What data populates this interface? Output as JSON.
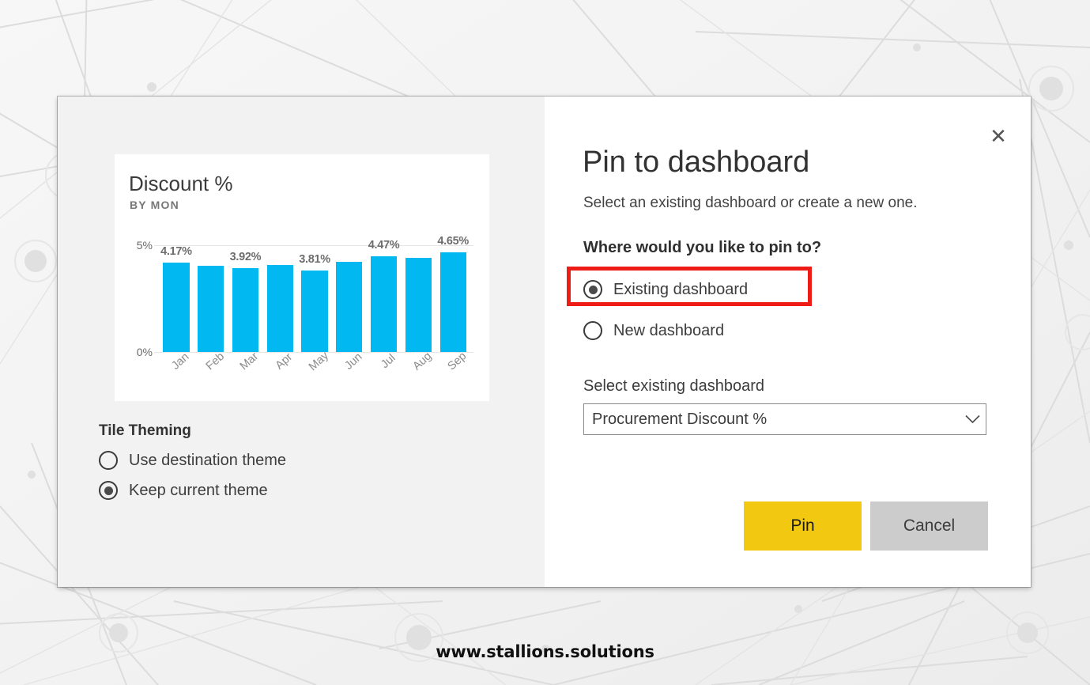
{
  "watermark": "www.stallions.solutions",
  "dialog": {
    "close_icon": "close-icon",
    "title": "Pin to dashboard",
    "subtitle": "Select an existing dashboard or create a new one.",
    "where_heading": "Where would you like to pin to?",
    "destination_options": [
      {
        "label": "Existing dashboard",
        "checked": true,
        "highlighted": true
      },
      {
        "label": "New dashboard",
        "checked": false,
        "highlighted": false
      }
    ],
    "select_label": "Select existing dashboard",
    "select_value": "Procurement Discount %",
    "select_icon": "chevron-down-icon",
    "pin_label": "Pin",
    "cancel_label": "Cancel",
    "highlight_color": "#ee1c16",
    "pin_button_color": "#f2c811",
    "cancel_button_color": "#cccccc"
  },
  "tile_theming": {
    "title": "Tile Theming",
    "options": [
      {
        "label": "Use destination theme",
        "checked": false
      },
      {
        "label": "Keep current theme",
        "checked": true
      }
    ]
  },
  "chart_data": {
    "type": "bar",
    "title": "Discount %",
    "subtitle": "BY MON",
    "xlabel": "",
    "ylabel": "",
    "categories": [
      "Jan",
      "Feb",
      "Mar",
      "Apr",
      "May",
      "Jun",
      "Jul",
      "Aug",
      "Sep"
    ],
    "values": [
      4.17,
      4.02,
      3.92,
      4.07,
      3.81,
      4.22,
      4.47,
      4.42,
      4.65
    ],
    "data_labels": [
      "4.17%",
      "",
      "3.92%",
      "",
      "3.81%",
      "",
      "4.47%",
      "",
      "4.65%"
    ],
    "ylim": [
      0,
      5
    ],
    "yticks": [
      0,
      5
    ],
    "ytick_labels": [
      "0%",
      "5%"
    ],
    "grid": true,
    "legend": "none",
    "series_color": "#01b8f1"
  }
}
